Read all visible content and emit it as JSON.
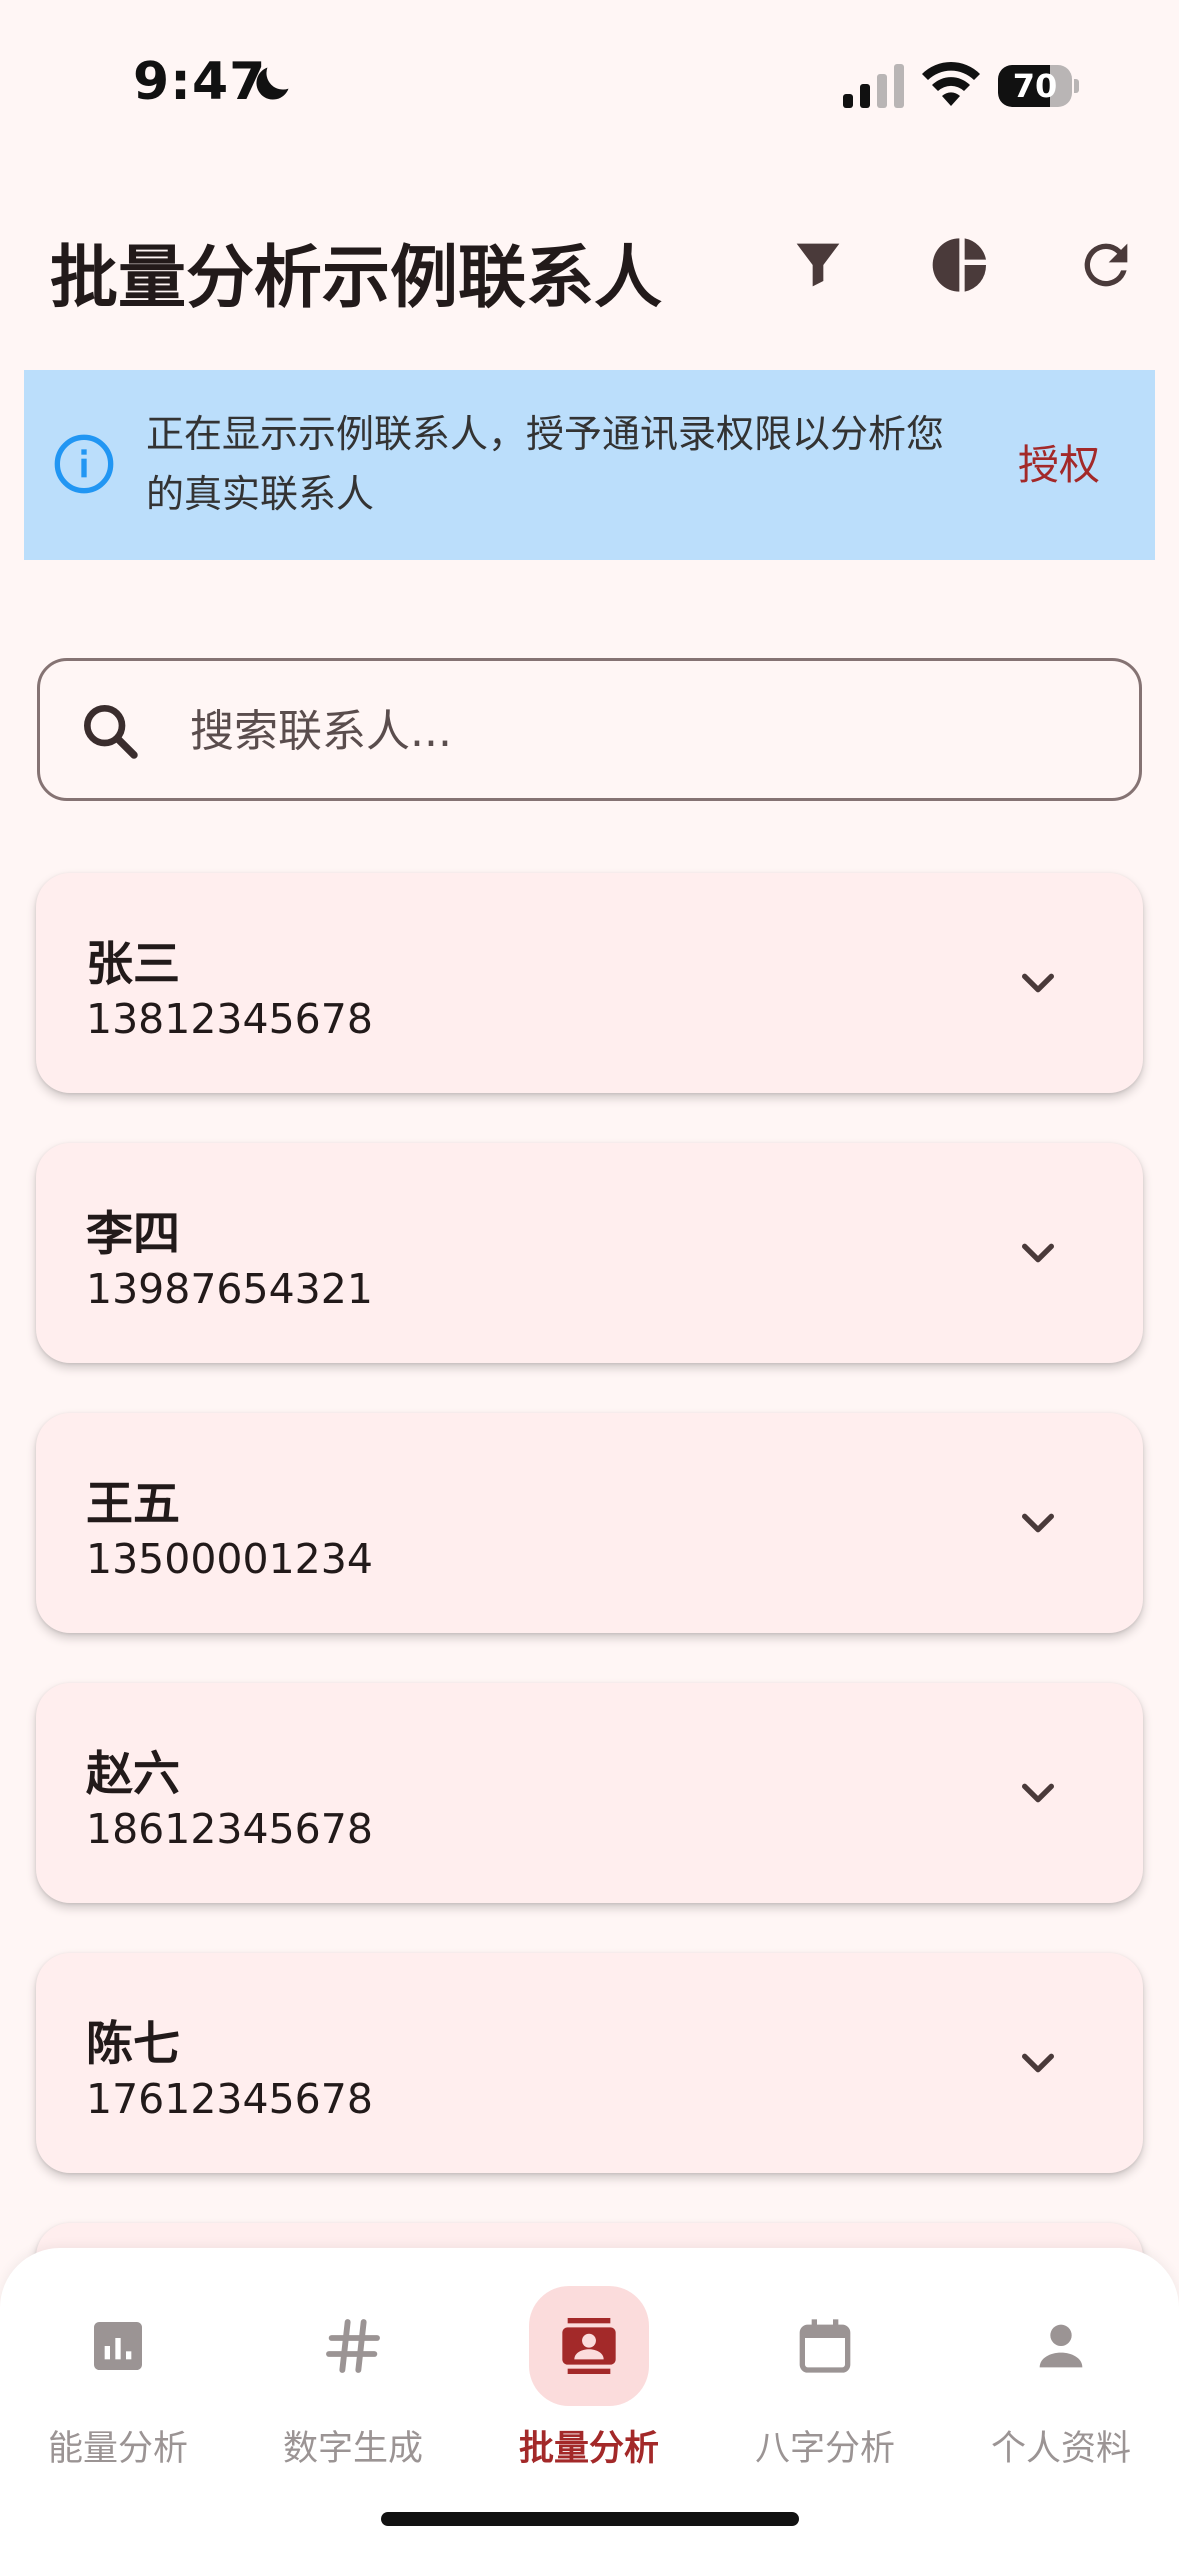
{
  "status_bar": {
    "time": "9:47",
    "battery_level": "70",
    "battery_fraction": 0.7
  },
  "app_bar": {
    "title": "批量分析示例联系人",
    "actions": [
      "filter-icon",
      "pie-chart-icon",
      "refresh-icon"
    ]
  },
  "banner": {
    "text": "正在显示示例联系人，授予通讯录权限以分析您的真实联系人",
    "action_label": "授权",
    "background": "#bbdefb",
    "icon_color": "#2196f3"
  },
  "search": {
    "placeholder": "搜索联系人...",
    "value": ""
  },
  "contacts": [
    {
      "name": "张三",
      "phone": "13812345678"
    },
    {
      "name": "李四",
      "phone": "13987654321"
    },
    {
      "name": "王五",
      "phone": "13500001234"
    },
    {
      "name": "赵六",
      "phone": "18612345678"
    },
    {
      "name": "陈七",
      "phone": "17612345678"
    }
  ],
  "bottom_nav": {
    "items": [
      {
        "label": "能量分析",
        "icon": "bar-chart-icon",
        "active": false
      },
      {
        "label": "数字生成",
        "icon": "hash-icon",
        "active": false
      },
      {
        "label": "批量分析",
        "icon": "contacts-icon",
        "active": true
      },
      {
        "label": "八字分析",
        "icon": "calendar-icon",
        "active": false
      },
      {
        "label": "个人资料",
        "icon": "person-icon",
        "active": false
      }
    ]
  },
  "colors": {
    "accent": "#a32929",
    "background": "#fff6f5",
    "card": "#ffeeee",
    "inactive": "#9b9494"
  }
}
